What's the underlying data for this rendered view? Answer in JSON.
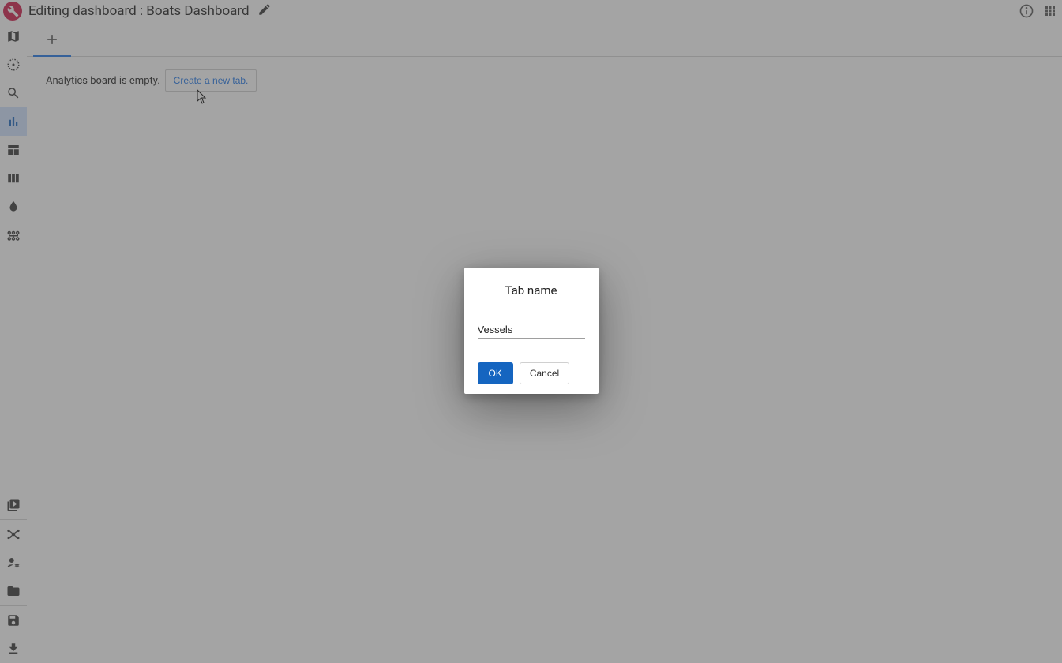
{
  "header": {
    "title": "Editing dashboard : Boats Dashboard"
  },
  "sidebar": {
    "items_top": [
      {
        "name": "map"
      },
      {
        "name": "timeline"
      },
      {
        "name": "search"
      },
      {
        "name": "analytics",
        "active": true
      },
      {
        "name": "table"
      },
      {
        "name": "columns"
      },
      {
        "name": "opacity"
      },
      {
        "name": "rca"
      }
    ],
    "items_bottom_a": [
      {
        "name": "library"
      }
    ],
    "items_bottom_b": [
      {
        "name": "hub"
      },
      {
        "name": "manage-accounts"
      },
      {
        "name": "folder"
      }
    ],
    "items_bottom_c": [
      {
        "name": "save"
      },
      {
        "name": "download"
      }
    ]
  },
  "main": {
    "empty_text": "Analytics board is empty.",
    "create_tab_label": "Create a new tab."
  },
  "dialog": {
    "title": "Tab name",
    "input_value": "Vessels",
    "ok_label": "OK",
    "cancel_label": "Cancel"
  }
}
